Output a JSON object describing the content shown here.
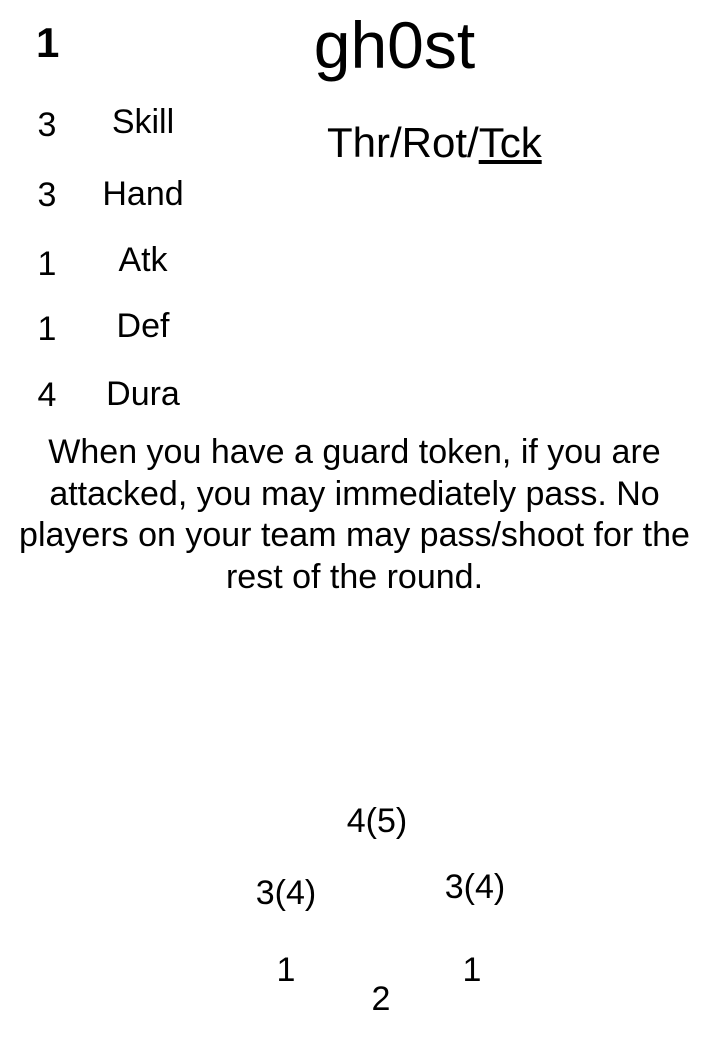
{
  "card": {
    "cost": "1",
    "name": "gh0st",
    "roles": {
      "items": [
        "Thr",
        "Rot",
        "Tck"
      ],
      "separator": "/",
      "active": "Tck"
    },
    "stats": [
      {
        "value": "3",
        "label": "Skill"
      },
      {
        "value": "3",
        "label": "Hand"
      },
      {
        "value": "1",
        "label": "Atk"
      },
      {
        "value": "1",
        "label": "Def"
      },
      {
        "value": "4",
        "label": "Dura"
      }
    ],
    "ability": "When you have a guard token, if you are attacked, you may immediately pass. No players on your team may pass/shoot for the rest of the round.",
    "zones": {
      "top": "4(5)",
      "left_mid": "3(4)",
      "right_mid": "3(4)",
      "left_low": "1",
      "right_low": "1",
      "bottom": "2"
    }
  }
}
